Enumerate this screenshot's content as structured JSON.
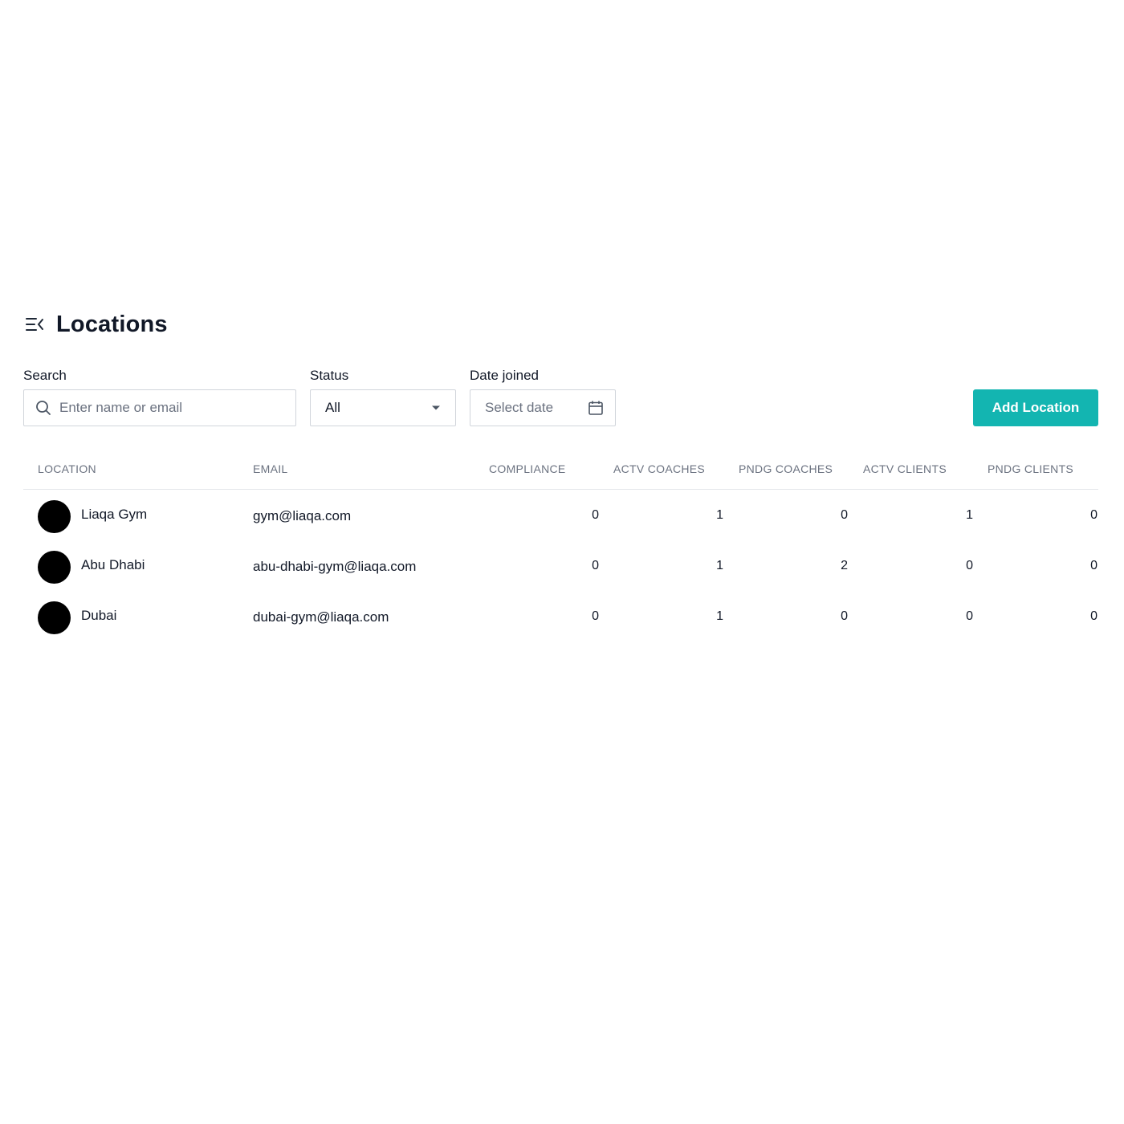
{
  "header": {
    "title": "Locations",
    "menu_icon": "menu-collapse-icon"
  },
  "filters": {
    "search": {
      "label": "Search",
      "placeholder": "Enter name or email",
      "value": ""
    },
    "status": {
      "label": "Status",
      "value": "All"
    },
    "date_joined": {
      "label": "Date joined",
      "placeholder": "Select date"
    }
  },
  "actions": {
    "add_label": "Add Location"
  },
  "colors": {
    "accent": "#13b5b1",
    "avatar": "#000000",
    "border": "#d1d5db"
  },
  "table": {
    "columns": [
      "LOCATION",
      "EMAIL",
      "COMPLIANCE",
      "ACTV COACHES",
      "PNDG COACHES",
      "ACTV CLIENTS",
      "PNDG CLIENTS"
    ],
    "rows": [
      {
        "name": "Liaqa Gym",
        "email": "gym@liaqa.com",
        "compliance": "0",
        "actv_coaches": "1",
        "pndg_coaches": "0",
        "actv_clients": "1",
        "pndg_clients": "0"
      },
      {
        "name": "Abu Dhabi",
        "email": "abu-dhabi-gym@liaqa.com",
        "compliance": "0",
        "actv_coaches": "1",
        "pndg_coaches": "2",
        "actv_clients": "0",
        "pndg_clients": "0"
      },
      {
        "name": "Dubai",
        "email": "dubai-gym@liaqa.com",
        "compliance": "0",
        "actv_coaches": "1",
        "pndg_coaches": "0",
        "actv_clients": "0",
        "pndg_clients": "0"
      }
    ]
  }
}
